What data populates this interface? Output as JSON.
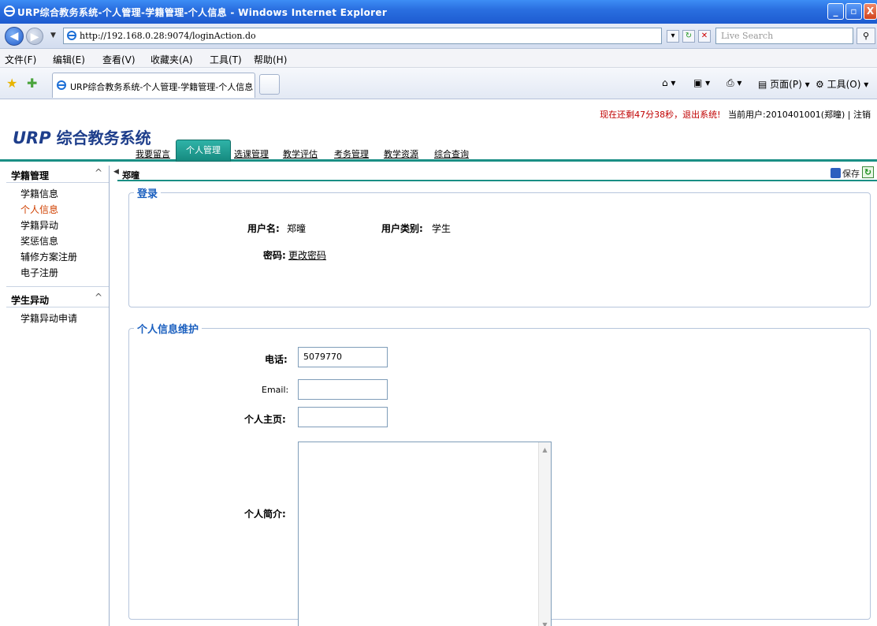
{
  "window": {
    "title": "URP综合教务系统-个人管理-学籍管理-个人信息 - Windows Internet Explorer",
    "url": "http://192.168.0.28:9074/loginAction.do",
    "search_placeholder": "Live Search"
  },
  "menubar": [
    "文件(F)",
    "编辑(E)",
    "查看(V)",
    "收藏夹(A)",
    "工具(T)",
    "帮助(H)"
  ],
  "browser_tab": {
    "label": "URP综合教务系统-个人管理-学籍管理-个人信息"
  },
  "commandbar": {
    "page": "页面(P)",
    "tools": "工具(O)"
  },
  "app": {
    "logo_urp": "URP",
    "logo_text": "综合教务系统",
    "session_notice": "现在还剩47分38秒，退出系统!",
    "current_user": "当前用户:2010401001(郑曈)",
    "logout": "注销",
    "tabs": [
      "我要留言",
      "个人管理",
      "选课管理",
      "教学评估",
      "考务管理",
      "教学资源",
      "综合查询"
    ],
    "active_tab": "个人管理"
  },
  "sidebar": {
    "groups": [
      {
        "title": "学籍管理",
        "items": [
          "学籍信息",
          "个人信息",
          "学籍异动",
          "奖惩信息",
          "辅修方案注册",
          "电子注册"
        ],
        "active": "个人信息"
      },
      {
        "title": "学生异动",
        "items": [
          "学籍异动申请"
        ]
      }
    ]
  },
  "content": {
    "breadcrumb": "郑曈",
    "save_label": "保存",
    "login_section": {
      "legend": "登录",
      "username_label": "用户名:",
      "username_value": "郑曈",
      "usertype_label": "用户类别:",
      "usertype_value": "学生",
      "password_label": "密码:",
      "password_link": "更改密码"
    },
    "info_section": {
      "legend": "个人信息维护",
      "phone_label": "电话:",
      "phone_value": "5079770",
      "email_label": "Email:",
      "email_value": "",
      "homepage_label": "个人主页:",
      "homepage_value": "",
      "bio_label": "个人简介:"
    }
  }
}
